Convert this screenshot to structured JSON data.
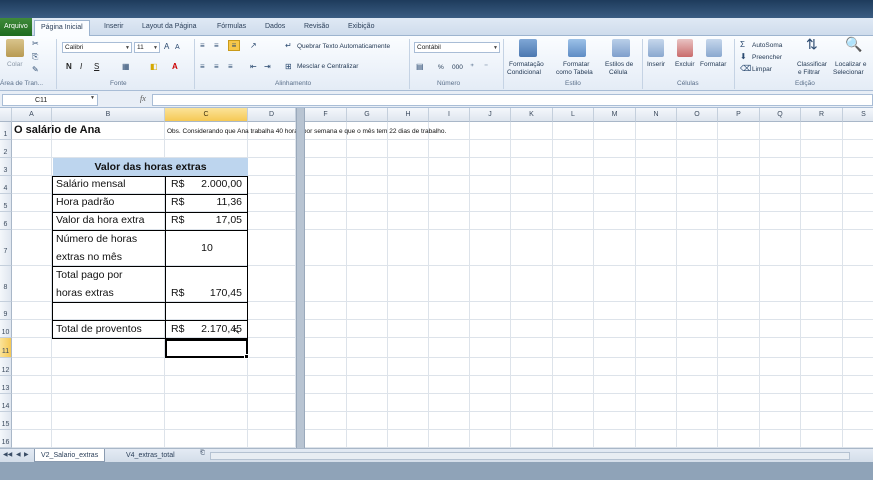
{
  "ribbon_tabs": [
    "Arquivo",
    "Página Inicial",
    "Inserir",
    "Layout da Página",
    "Fórmulas",
    "Dados",
    "Revisão",
    "Exibição"
  ],
  "clipboard": {
    "paste_label": "Colar",
    "group_label": "Área de Tran..."
  },
  "font": {
    "name": "Calibri",
    "size": "11",
    "bold": "N",
    "italic": "I",
    "underline": "S",
    "group_label": "Fonte"
  },
  "alignment": {
    "wrap_text": "Quebrar Texto Automaticamente",
    "merge_center": "Mesclar e Centralizar",
    "group_label": "Alinhamento"
  },
  "number": {
    "format": "Contábil",
    "percent": "%",
    "thousands": "000",
    "group_label": "Número"
  },
  "styles": {
    "cond_format_1": "Formatação",
    "cond_format_2": "Condicional",
    "format_table_1": "Formatar",
    "format_table_2": "como Tabela",
    "cell_styles_1": "Estilos de",
    "cell_styles_2": "Célula",
    "group_label": "Estilo"
  },
  "cells": {
    "insert": "Inserir",
    "delete": "Excluir",
    "format": "Formatar",
    "group_label": "Células"
  },
  "editing": {
    "autosum": "AutoSoma",
    "fill": "Preencher",
    "clear": "Limpar",
    "sort_1": "Classificar",
    "sort_2": "e Filtrar",
    "find_1": "Localizar e",
    "find_2": "Selecionar",
    "group_label": "Edição"
  },
  "formula_bar": {
    "name_box": "C11",
    "fx": "fx",
    "formula": ""
  },
  "columns": [
    "A",
    "B",
    "C",
    "D",
    "E",
    "F",
    "G",
    "H",
    "I",
    "J",
    "K",
    "L",
    "M",
    "N",
    "O",
    "P",
    "Q",
    "R",
    "S"
  ],
  "rows": [
    "1",
    "2",
    "3",
    "4",
    "5",
    "6",
    "7",
    "8",
    "9",
    "10",
    "11",
    "12",
    "13",
    "14",
    "15",
    "16"
  ],
  "sheet": {
    "title": "O salário de Ana",
    "note": "Obs. Considerando que Ana trabalha 40 horas por semana e que o mês tem 22 dias de trabalho.",
    "table_header": "Valor das horas extras",
    "labels": {
      "salario": "Salário mensal",
      "hora_padrao": "Hora padrão",
      "valor_hora_extra": "Valor da hora extra",
      "num_horas_1": "Número de horas",
      "num_horas_2": "extras no mês",
      "total_pago_1": "Total pago por",
      "total_pago_2": "horas extras",
      "total_proventos": "Total de proventos"
    },
    "values": {
      "currency": "R$",
      "salario": "2.000,00",
      "hora_padrao": "11,36",
      "valor_hora_extra": "17,05",
      "num_horas": "10",
      "total_pago": "170,45",
      "total_proventos": "2.170,45"
    }
  },
  "sheet_tabs": [
    "V2_Salario_extras",
    "V4_extras_total"
  ]
}
